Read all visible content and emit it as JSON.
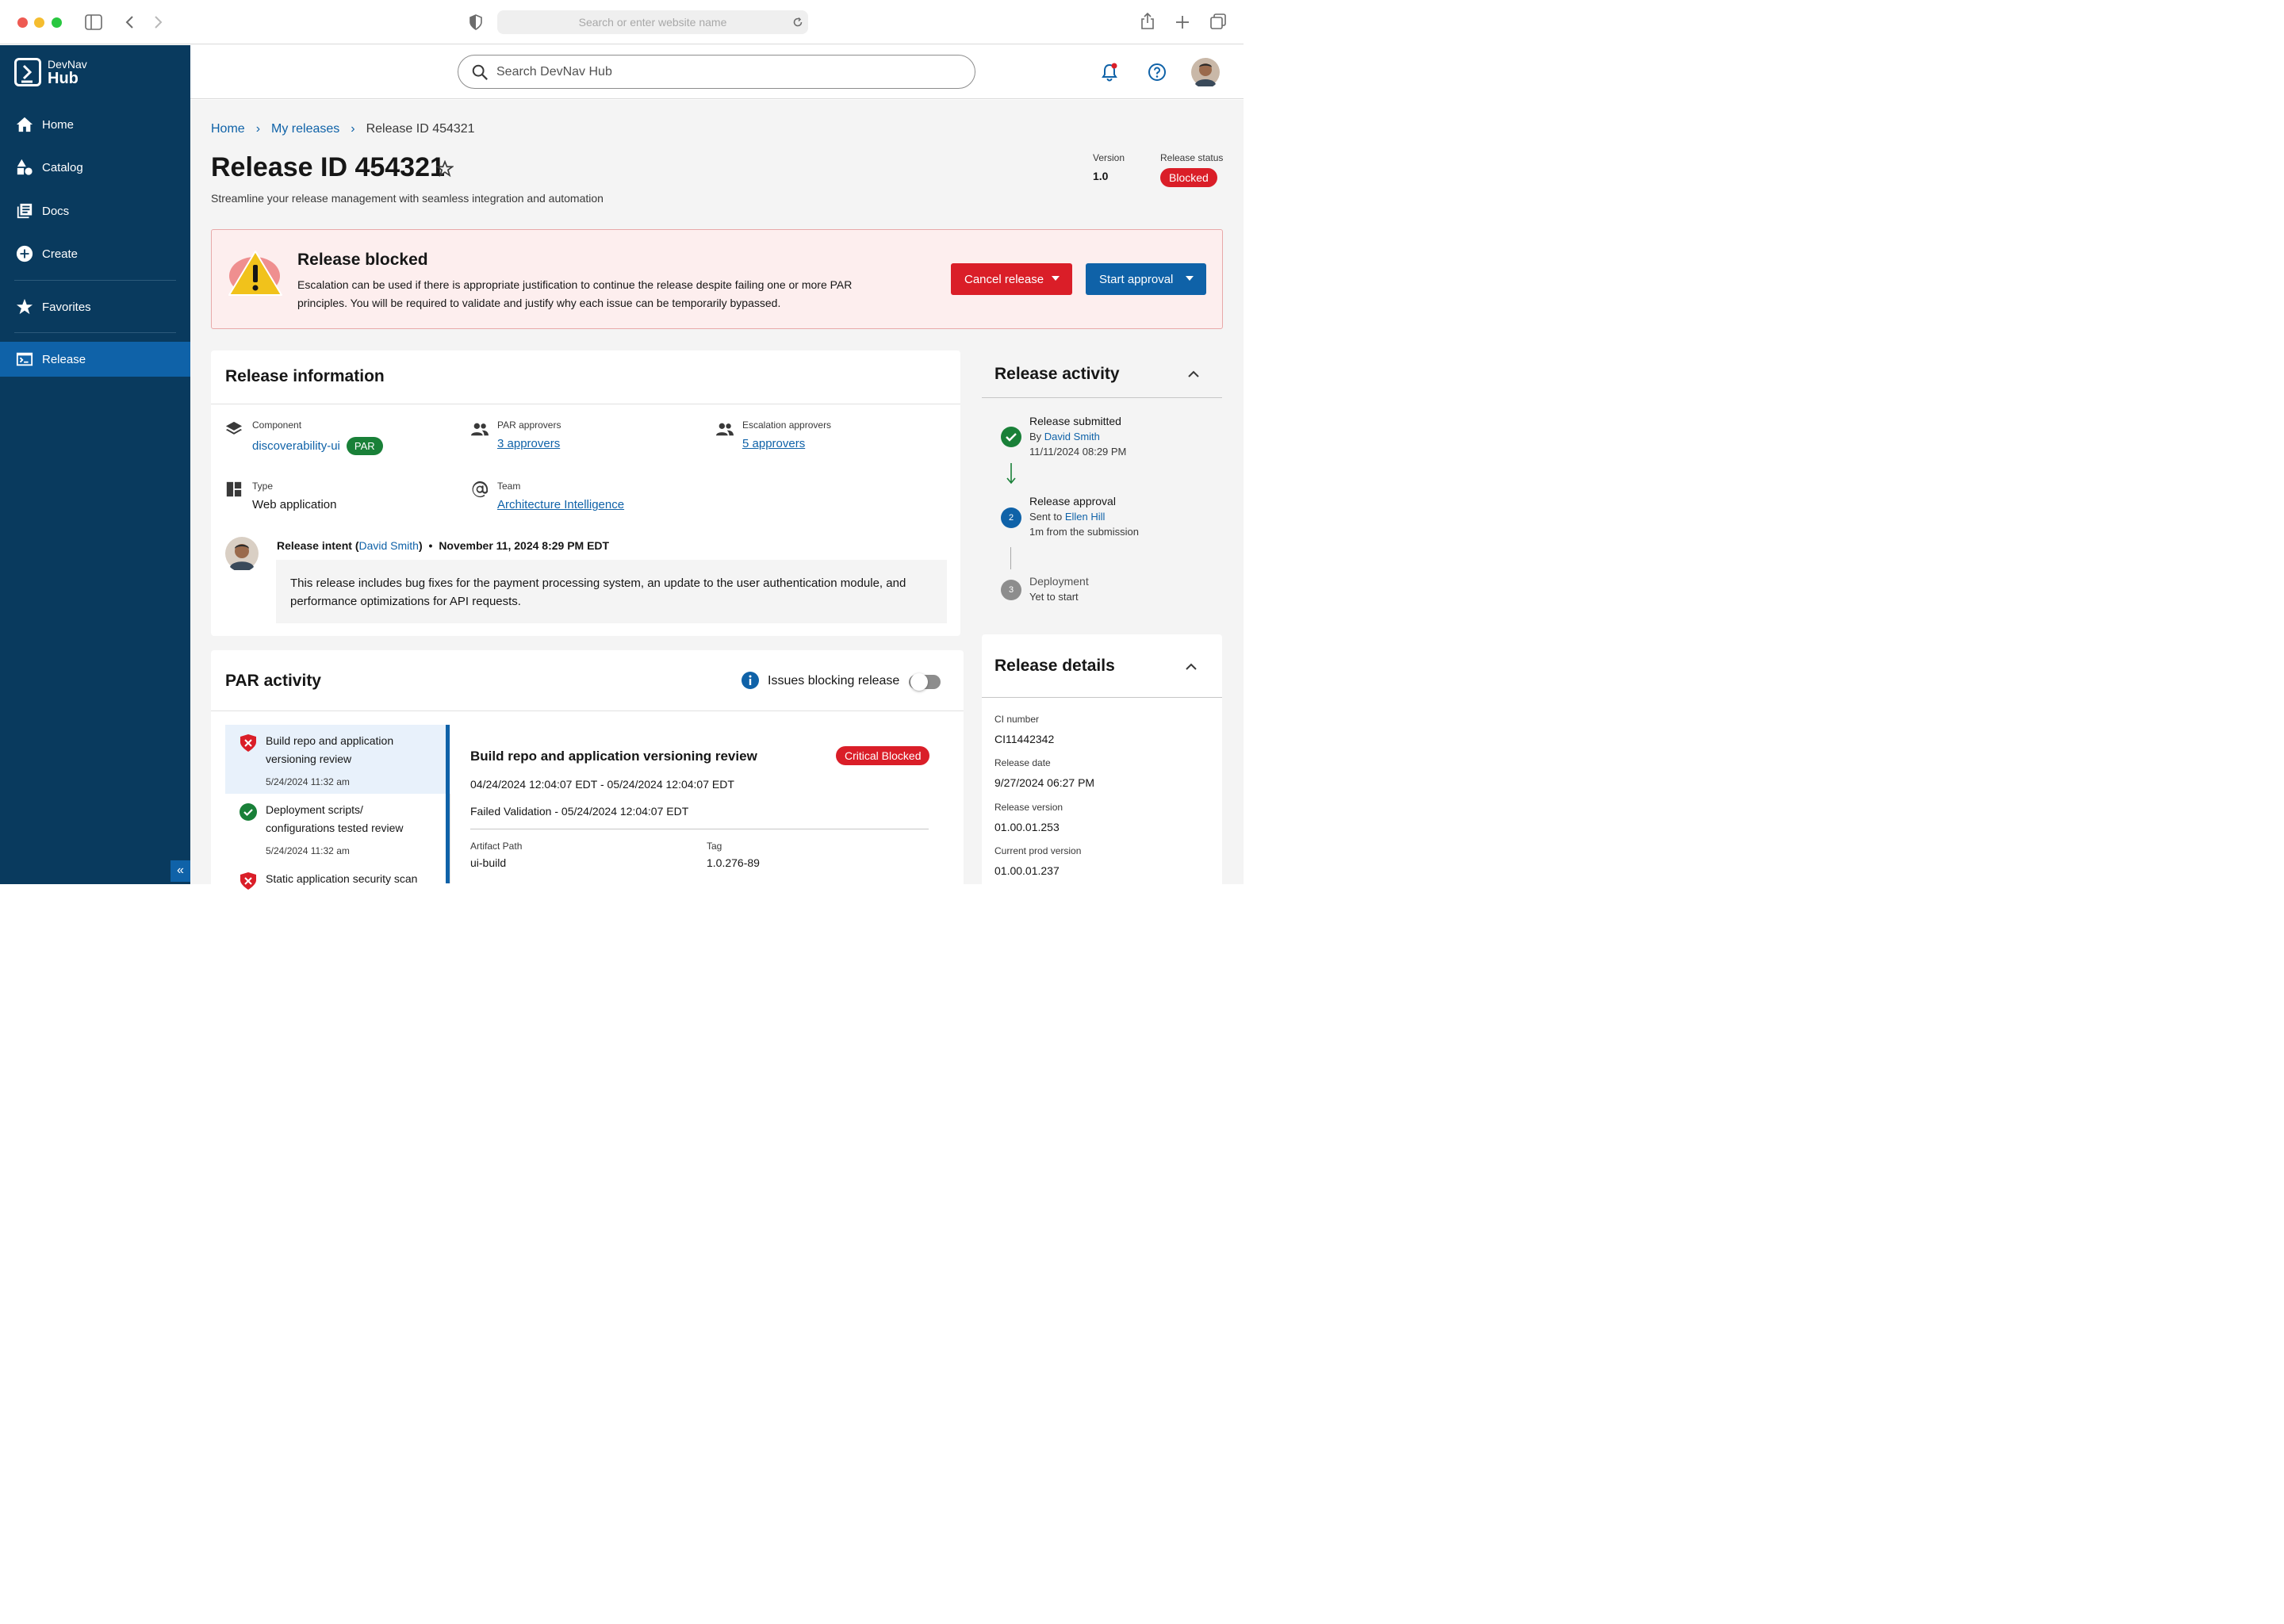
{
  "browser": {
    "url_placeholder": "Search or enter website name"
  },
  "sidebar": {
    "brand_top": "DevNav",
    "brand_bottom": "Hub",
    "items": [
      {
        "label": "Home",
        "icon": "home-icon"
      },
      {
        "label": "Catalog",
        "icon": "catalog-icon"
      },
      {
        "label": "Docs",
        "icon": "docs-icon"
      },
      {
        "label": "Create",
        "icon": "create-icon"
      },
      {
        "label": "Favorites",
        "icon": "star-icon"
      },
      {
        "label": "Release",
        "icon": "terminal-icon",
        "active": true
      }
    ],
    "collapse_glyph": "«"
  },
  "topbar": {
    "search_placeholder": "Search DevNav Hub"
  },
  "breadcrumb": [
    "Home",
    "My releases",
    "Release ID 454321"
  ],
  "page": {
    "title": "Release ID 454321",
    "subtitle": "Streamline your release management with seamless integration and automation",
    "version_label": "Version",
    "version_value": "1.0",
    "status_label": "Release status",
    "status_value": "Blocked"
  },
  "alert": {
    "title": "Release blocked",
    "body": "Escalation can be used if there is appropriate justification to continue the release despite failing one or more PAR principles. You will be required to validate and justify why each issue can be temporarily bypassed.",
    "cancel_label": "Cancel release",
    "approve_label": "Start approval",
    "colors": {
      "cancel": "#da1e28",
      "approve": "#0f62a8"
    }
  },
  "release_info": {
    "title": "Release information",
    "component_label": "Component",
    "component_value": "discoverability-ui",
    "component_badge": "PAR",
    "par_label": "PAR approvers",
    "par_value": "3 approvers",
    "esc_label": "Escalation approvers",
    "esc_value": "5 approvers",
    "type_label": "Type",
    "type_value": "Web application",
    "team_label": "Team",
    "team_value": "Architecture Intelligence",
    "intent_prefix": "Release intent (",
    "intent_user": "David Smith",
    "intent_suffix": ")",
    "intent_date": "November 11, 2024 8:29 PM EDT",
    "intent_text": "This release includes bug fixes for the payment processing system, an update to the user authentication module, and performance optimizations for API requests."
  },
  "par_activity": {
    "title": "PAR activity",
    "toggle_label": "Issues blocking release",
    "items": [
      {
        "title": "Build repo and application versioning review",
        "date": "5/24/2024 11:32 am",
        "status": "blocked"
      },
      {
        "title": "Deployment scripts/ configurations tested review",
        "date": "5/24/2024 11:32 am",
        "status": "passed"
      },
      {
        "title": "Static application security scan",
        "date": "",
        "status": "blocked"
      }
    ],
    "detail": {
      "title": "Build repo and application versioning review",
      "badge": "Critical Blocked",
      "range": "04/24/2024 12:04:07 EDT - 05/24/2024 12:04:07 EDT",
      "failed": "Failed Validation - 05/24/2024 12:04:07 EDT",
      "artifact_label": "Artifact Path",
      "artifact_value": "ui-build",
      "tag_label": "Tag",
      "tag_value": "1.0.276-89"
    }
  },
  "release_activity": {
    "title": "Release activity",
    "steps": [
      {
        "title": "Release submitted",
        "line1_prefix": "By ",
        "line1_link": "David Smith",
        "line2": "11/11/2024 08:29 PM",
        "state": "done"
      },
      {
        "title": "Release approval",
        "line1_prefix": "Sent to ",
        "line1_link": "Ellen Hill",
        "line2": "1m from the submission",
        "state": "current",
        "num": "2"
      },
      {
        "title": "Deployment",
        "line1_prefix": "Yet to start",
        "line1_link": "",
        "line2": "",
        "state": "pending",
        "num": "3"
      }
    ]
  },
  "release_details": {
    "title": "Release details",
    "fields": [
      {
        "label": "CI number",
        "value": "CI11442342"
      },
      {
        "label": "Release date",
        "value": "9/27/2024 06:27 PM"
      },
      {
        "label": "Release version",
        "value": "01.00.01.253"
      },
      {
        "label": "Current prod version",
        "value": "01.00.01.237"
      }
    ]
  }
}
